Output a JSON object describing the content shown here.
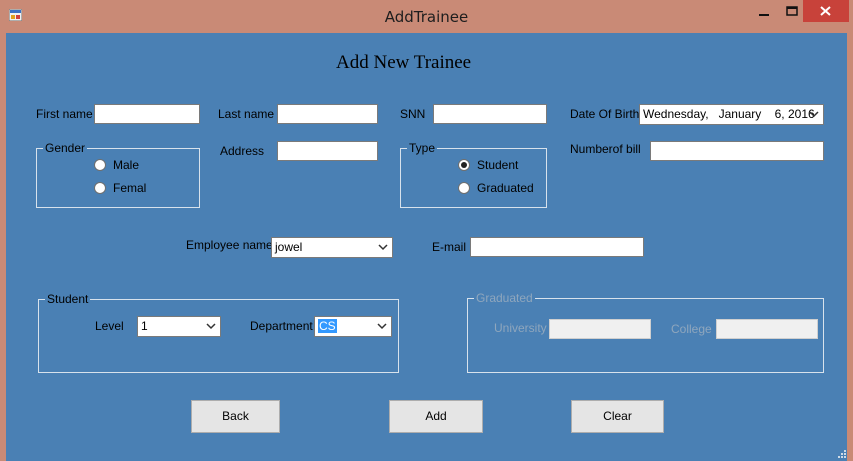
{
  "window": {
    "title": "AddTrainee"
  },
  "heading": "Add New Trainee",
  "fields": {
    "first_name_label": "First name",
    "last_name_label": "Last name",
    "snn_label": "SNN",
    "dob_label": "Date Of Birth",
    "dob_value": "Wednesday,   January    6, 2016",
    "address_label": "Address",
    "number_of_bill_label": "Numberof bill",
    "employee_name_label": "Employee name",
    "employee_name_value": "jowel",
    "email_label": "E-mail"
  },
  "gender": {
    "title": "Gender",
    "options": [
      "Male",
      "Femal"
    ],
    "selected": "none"
  },
  "type": {
    "title": "Type",
    "options": [
      "Student",
      "Graduated"
    ],
    "selected": "Student"
  },
  "student": {
    "title": "Student",
    "level_label": "Level",
    "level_value": "1",
    "department_label": "Department",
    "department_value": "CS"
  },
  "graduated": {
    "title": "Graduated",
    "university_label": "University",
    "college_label": "College"
  },
  "buttons": {
    "back": "Back",
    "add": "Add",
    "clear": "Clear"
  },
  "colors": {
    "client_bg": "#4a80b4",
    "titlebar_bg": "#c98a76",
    "close_button": "#c8423a"
  }
}
